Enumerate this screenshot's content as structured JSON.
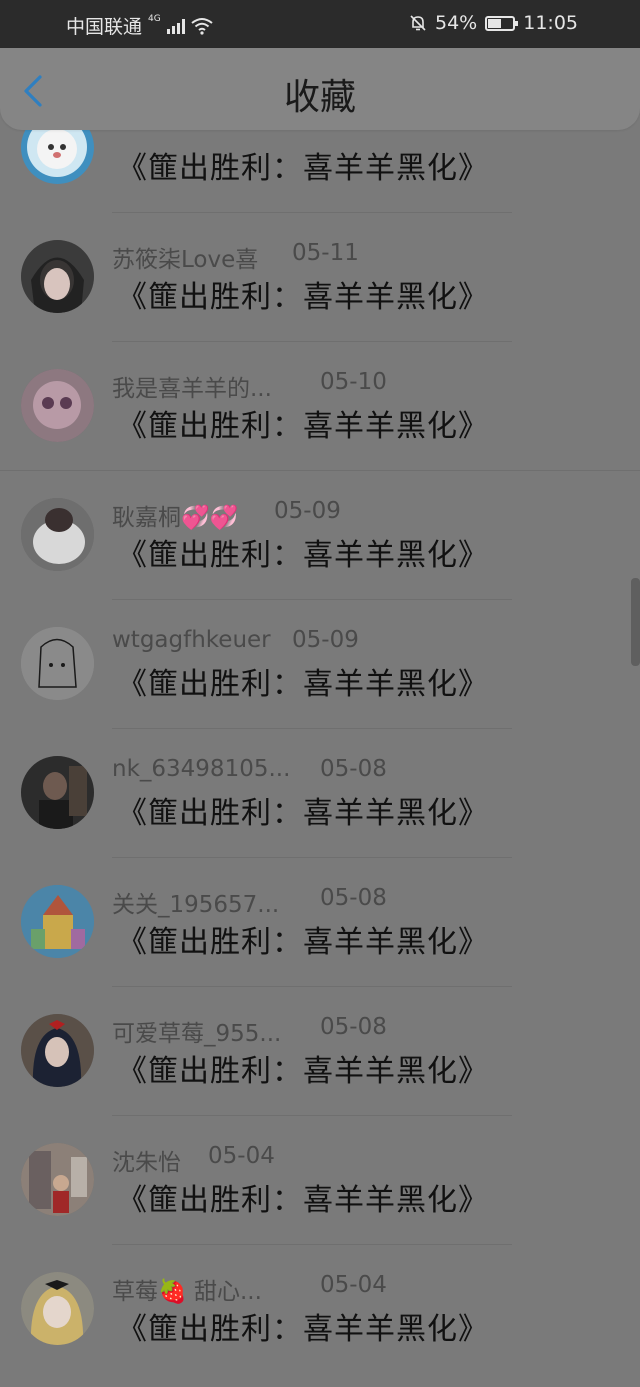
{
  "status_bar": {
    "carrier": "中国联通",
    "network": "4G",
    "battery": "54%",
    "battery_level": 0.54,
    "time": "11:05"
  },
  "header": {
    "title": "收藏"
  },
  "items": [
    {
      "name": "",
      "date": "",
      "work": "《篚出胜利：喜羊羊黑化》"
    },
    {
      "name": "苏筱柒Love喜",
      "date": "05-11",
      "work": "《篚出胜利：喜羊羊黑化》"
    },
    {
      "name": "我是喜羊羊的...",
      "date": "05-10",
      "work": "《篚出胜利：喜羊羊黑化》"
    },
    {
      "name": "耿嘉桐💞💞",
      "date": "05-09",
      "work": "《篚出胜利：喜羊羊黑化》"
    },
    {
      "name": "wtgagfhkeuer",
      "date": "05-09",
      "work": "《篚出胜利：喜羊羊黑化》"
    },
    {
      "name": "nk_63498105...",
      "date": "05-08",
      "work": "《篚出胜利：喜羊羊黑化》"
    },
    {
      "name": "关关_195657...",
      "date": "05-08",
      "work": "《篚出胜利：喜羊羊黑化》"
    },
    {
      "name": "可爱草莓_955...",
      "date": "05-08",
      "work": "《篚出胜利：喜羊羊黑化》"
    },
    {
      "name": "沈朱怡",
      "date": "05-04",
      "work": "《篚出胜利：喜羊羊黑化》"
    },
    {
      "name": "草莓🍓 甜心...",
      "date": "05-04",
      "work": "《篚出胜利：喜羊羊黑化》"
    }
  ],
  "colors": {
    "overlay_background": "#7a7a7a",
    "status_bar": "#2b2b2b",
    "back_arrow": "#2f7fc0"
  }
}
